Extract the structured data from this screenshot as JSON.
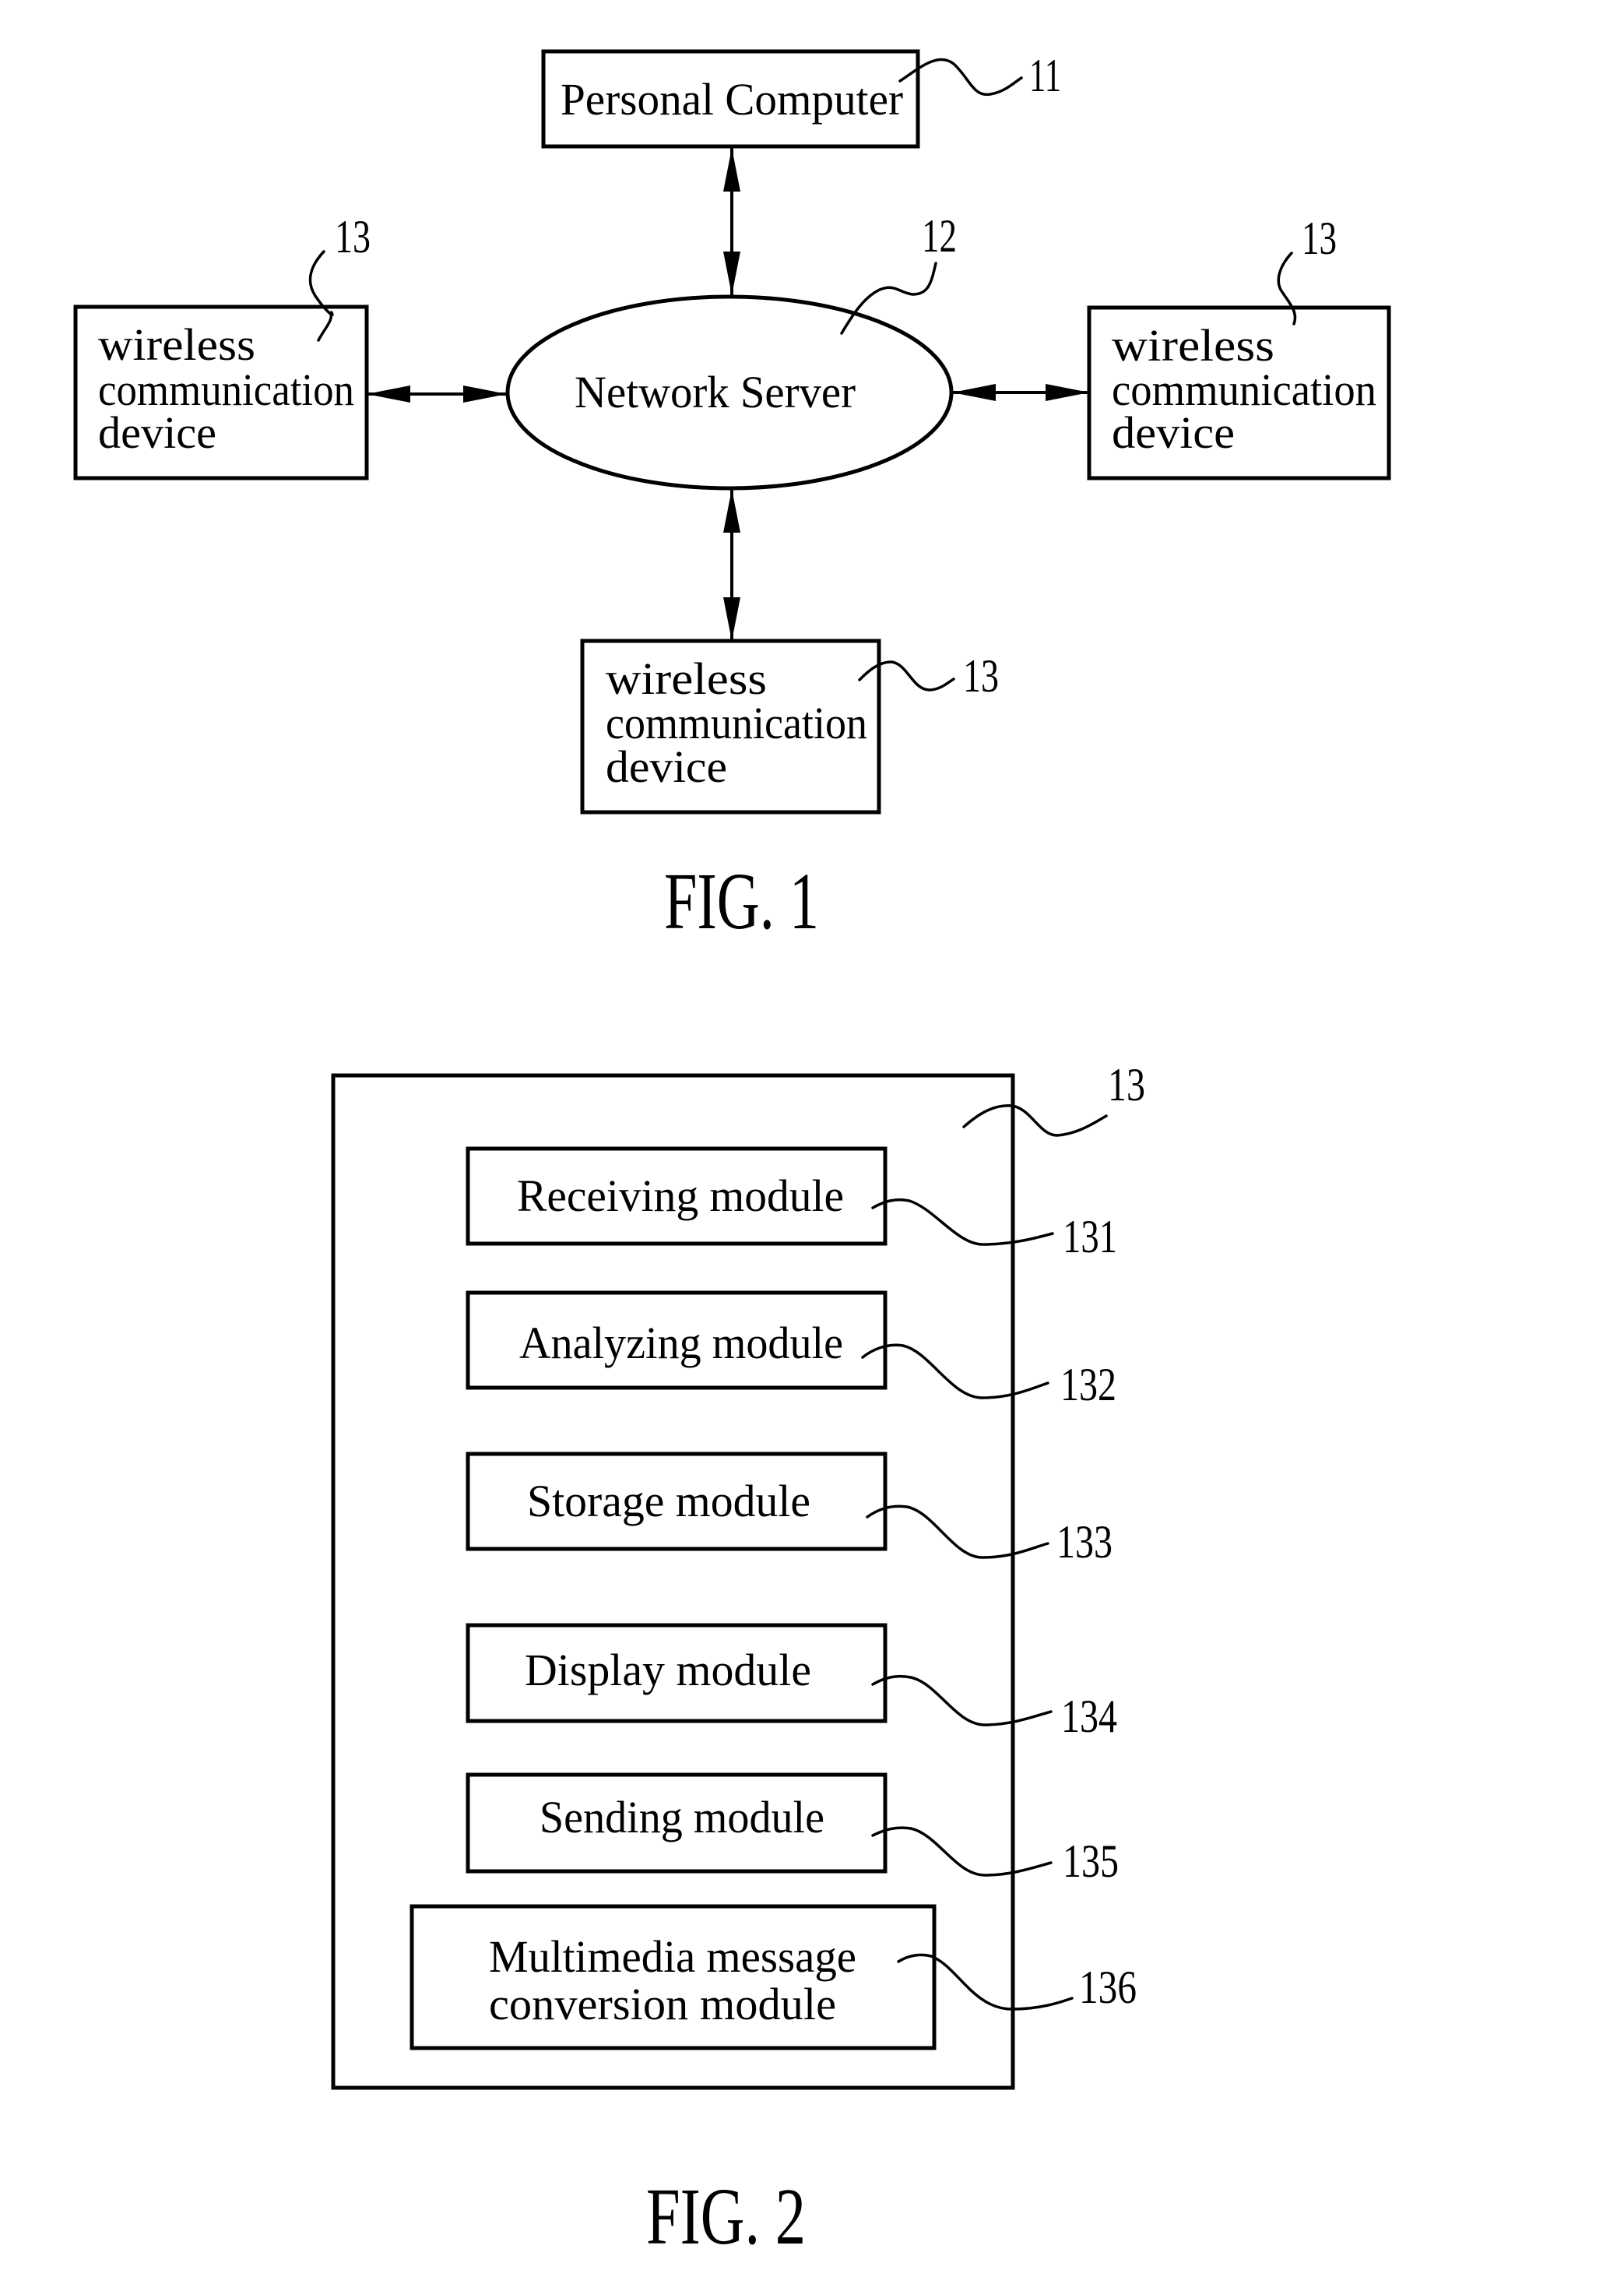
{
  "figure1": {
    "personal_computer": {
      "label": "Personal Computer",
      "ref": "11"
    },
    "network_server": {
      "label": "Network Server",
      "ref": "12"
    },
    "devices": [
      {
        "position": "left",
        "lines": [
          "wireless",
          "communication",
          "device"
        ],
        "ref": "13"
      },
      {
        "position": "right",
        "lines": [
          "wireless",
          "communication",
          "device"
        ],
        "ref": "13"
      },
      {
        "position": "bottom",
        "lines": [
          "wireless",
          "communication",
          "device"
        ],
        "ref": "13"
      }
    ],
    "caption": "FIG. 1"
  },
  "figure2": {
    "container_ref": "13",
    "modules": [
      {
        "lines": [
          "Receiving module"
        ],
        "ref": "131"
      },
      {
        "lines": [
          "Analyzing module"
        ],
        "ref": "132"
      },
      {
        "lines": [
          "Storage module"
        ],
        "ref": "133"
      },
      {
        "lines": [
          "Display module"
        ],
        "ref": "134"
      },
      {
        "lines": [
          "Sending module"
        ],
        "ref": "135"
      },
      {
        "lines": [
          "Multimedia message",
          "conversion module"
        ],
        "ref": "136"
      }
    ],
    "caption": "FIG. 2"
  }
}
